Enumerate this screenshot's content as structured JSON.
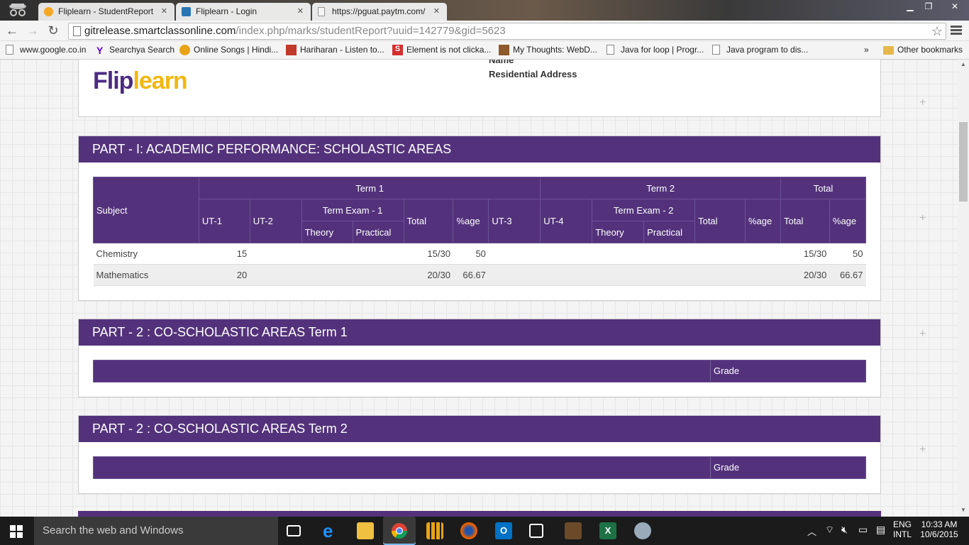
{
  "browser": {
    "tabs": [
      {
        "title": "Fliplearn - StudentReport",
        "favicon_color": "#f5a623"
      },
      {
        "title": "Fliplearn - Login",
        "favicon_color": "#2a7ab8"
      },
      {
        "title": "https://pguat.paytm.com/",
        "favicon_color": "#cccccc"
      }
    ],
    "url_host": "gitrelease.smartclassonline.com",
    "url_path": "/index.php/marks/studentReport?uuid=142779&gid=5623",
    "bookmarks": [
      {
        "label": "www.google.co.in",
        "icon": "page-icon"
      },
      {
        "label": "Searchya Search",
        "icon": "yahoo-icon"
      },
      {
        "label": "Online Songs | Hindi...",
        "icon": "music-icon"
      },
      {
        "label": "Hariharan - Listen to...",
        "icon": "music-icon"
      },
      {
        "label": "Element is not clicka...",
        "icon": "stackoverflow-icon"
      },
      {
        "label": "My Thoughts: WebD...",
        "icon": "blog-icon"
      },
      {
        "label": "Java for loop | Progr...",
        "icon": "page-icon"
      },
      {
        "label": "Java program to dis...",
        "icon": "page-icon"
      }
    ],
    "overflow": "»",
    "other_bookmarks": "Other bookmarks"
  },
  "report": {
    "logo_part1": "Flip",
    "logo_part2": "learn",
    "name_label": "Name",
    "address_label": "Residential Address",
    "part1_title": "PART - I: ACADEMIC PERFORMANCE: SCHOLASTIC AREAS",
    "headers": {
      "subject": "Subject",
      "term1": "Term 1",
      "term2": "Term 2",
      "total": "Total",
      "ut1": "UT-1",
      "ut2": "UT-2",
      "ut3": "UT-3",
      "ut4": "UT-4",
      "term_exam1": "Term Exam - 1",
      "term_exam2": "Term Exam - 2",
      "theory": "Theory",
      "practical": "Practical",
      "total_col": "Total",
      "pct": "%age"
    },
    "rows": [
      {
        "subject": "Chemistry",
        "ut1": "15",
        "ut2": "",
        "theory1": "",
        "practical1": "",
        "total1": "15/30",
        "pct1": "50",
        "ut3": "",
        "ut4": "",
        "theory2": "",
        "practical2": "",
        "total2": "",
        "pct2": "",
        "grand_total": "15/30",
        "grand_pct": "50"
      },
      {
        "subject": "Mathematics",
        "ut1": "20",
        "ut2": "",
        "theory1": "",
        "practical1": "",
        "total1": "20/30",
        "pct1": "66.67",
        "ut3": "",
        "ut4": "",
        "theory2": "",
        "practical2": "",
        "total2": "",
        "pct2": "",
        "grand_total": "20/30",
        "grand_pct": "66.67"
      }
    ],
    "part2_term1_title": "PART - 2 : CO-SCHOLASTIC AREAS Term 1",
    "part2_term2_title": "PART - 2 : CO-SCHOLASTIC AREAS Term 2",
    "grade_label": "Grade"
  },
  "colors": {
    "accent": "#53327b",
    "logo_purple": "#4b2c82",
    "logo_yellow": "#f2b713"
  },
  "taskbar": {
    "search_placeholder": "Search the web and Windows",
    "lang_top": "ENG",
    "lang_bottom": "INTL",
    "time": "10:33 AM",
    "date": "10/6/2015"
  }
}
